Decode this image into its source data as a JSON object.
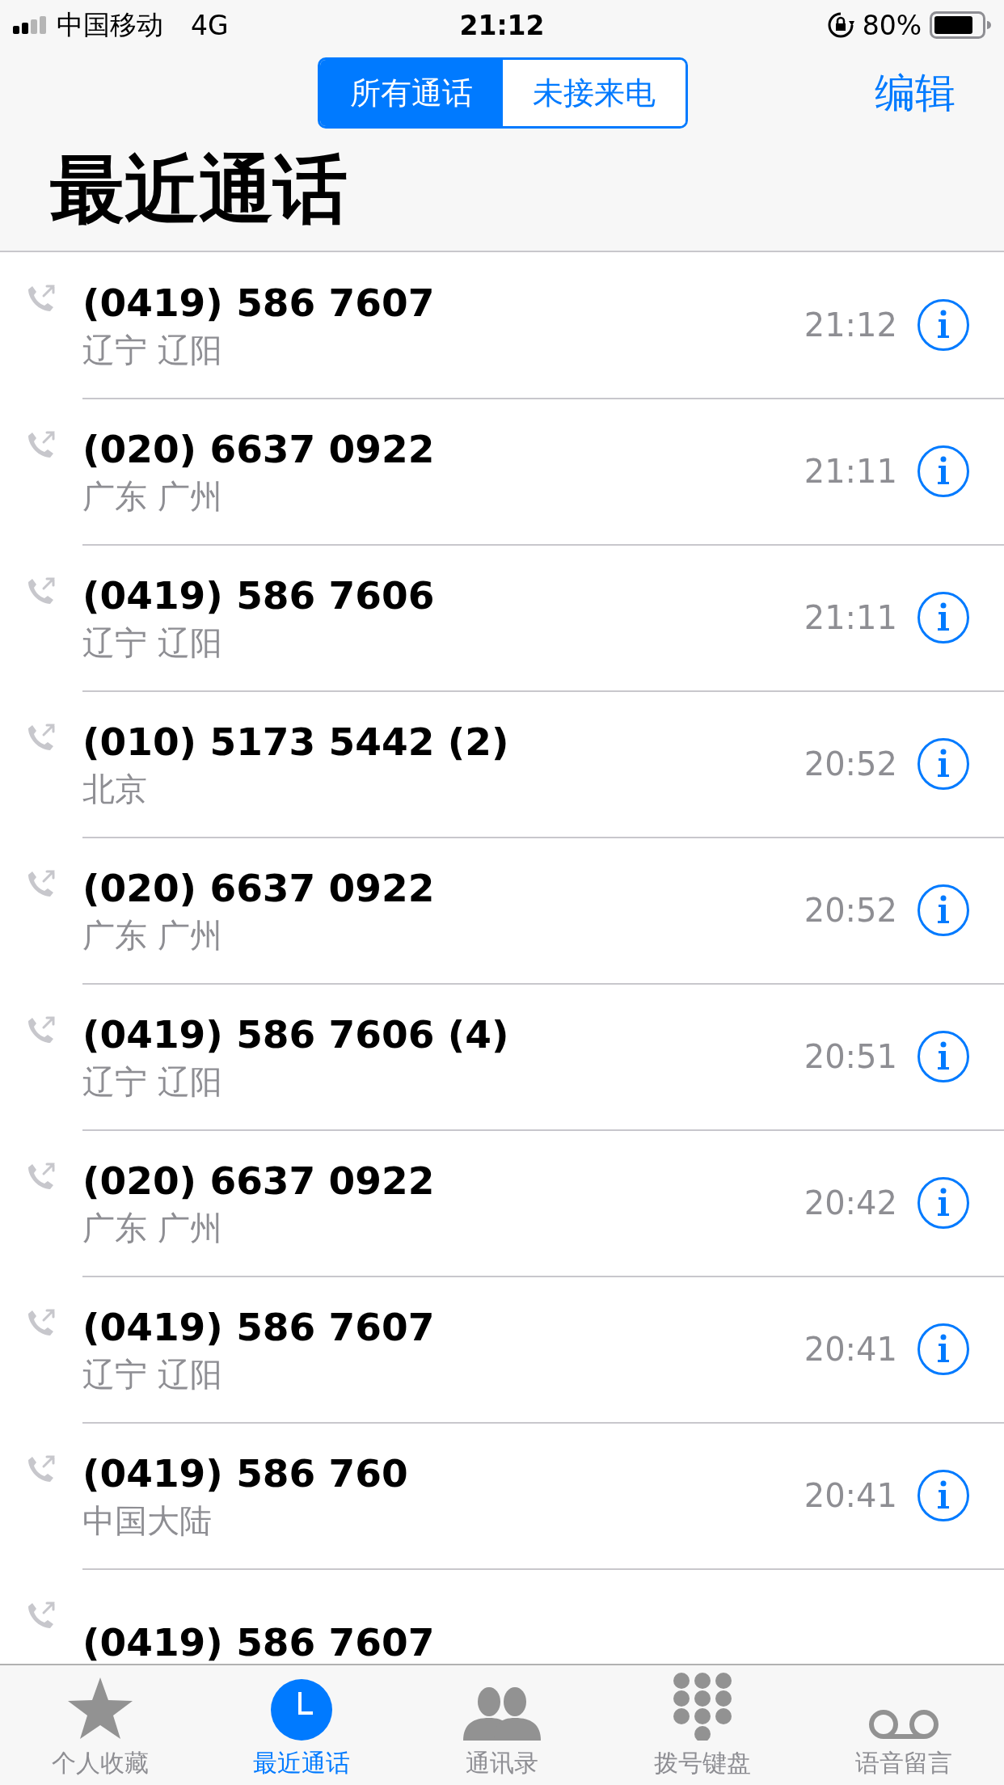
{
  "status_bar": {
    "carrier": "中国移动",
    "network": "4G",
    "time": "21:12",
    "battery": "80%"
  },
  "segments": [
    {
      "label": "所有通话",
      "selected": true
    },
    {
      "label": "未接来电",
      "selected": false
    }
  ],
  "edit_button": "编辑",
  "title": "最近通话",
  "calls": [
    {
      "number": "(0419) 586 7607",
      "location": "辽宁 辽阳",
      "time": "21:12"
    },
    {
      "number": "(020) 6637 0922",
      "location": "广东 广州",
      "time": "21:11"
    },
    {
      "number": "(0419) 586 7606",
      "location": "辽宁 辽阳",
      "time": "21:11"
    },
    {
      "number": "(010) 5173 5442 (2)",
      "location": "北京",
      "time": "20:52"
    },
    {
      "number": "(020) 6637 0922",
      "location": "广东 广州",
      "time": "20:52"
    },
    {
      "number": "(0419) 586 7606 (4)",
      "location": "辽宁 辽阳",
      "time": "20:51"
    },
    {
      "number": "(020) 6637 0922",
      "location": "广东 广州",
      "time": "20:42"
    },
    {
      "number": "(0419) 586 7607",
      "location": "辽宁 辽阳",
      "time": "20:41"
    },
    {
      "number": "(0419) 586 760",
      "location": "中国大陆",
      "time": "20:41"
    },
    {
      "number": "(0419) 586 7607"
    }
  ],
  "tabs": [
    {
      "kind": "favorites",
      "label": "个人收藏",
      "selected": false
    },
    {
      "kind": "recents",
      "label": "最近通话",
      "selected": true
    },
    {
      "kind": "contacts",
      "label": "通讯录",
      "selected": false
    },
    {
      "kind": "keypad",
      "label": "拨号键盘",
      "selected": false
    },
    {
      "kind": "voicemail",
      "label": "语音留言",
      "selected": false
    }
  ]
}
